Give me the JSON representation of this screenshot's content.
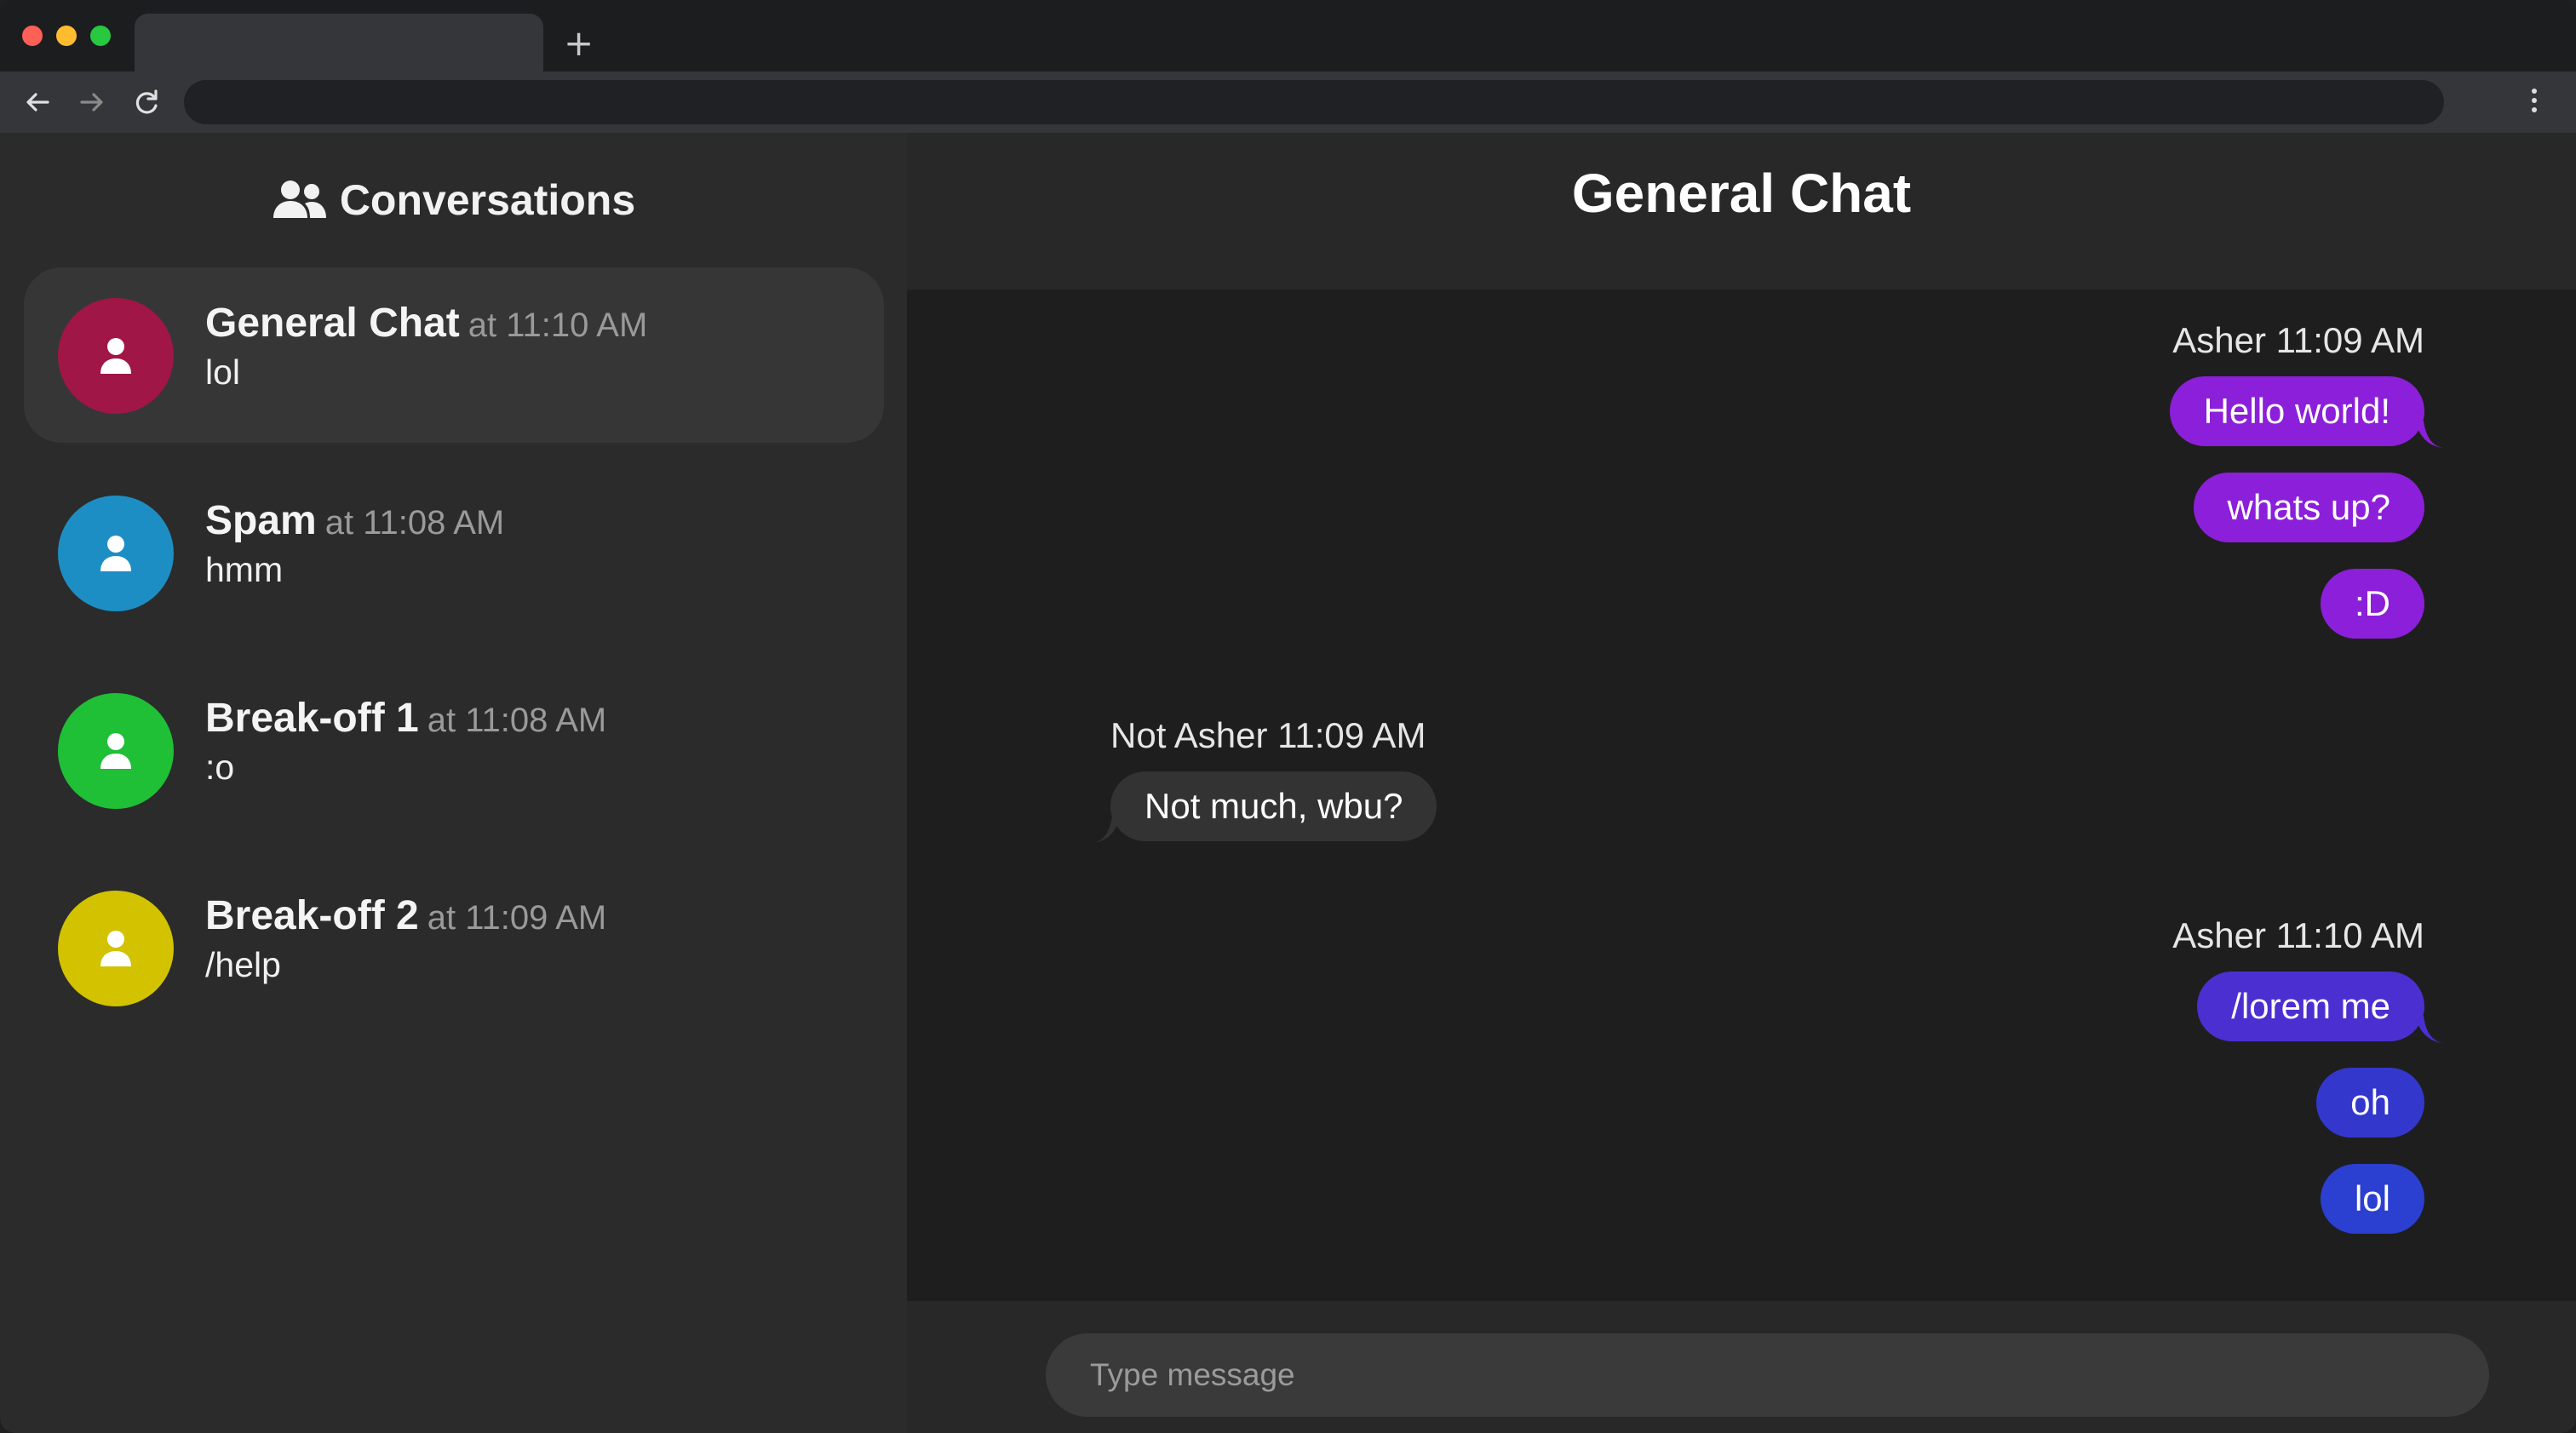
{
  "browser": {
    "tab_title": "",
    "new_tab_icon": "+",
    "url": ""
  },
  "sidebar": {
    "title": "Conversations",
    "conversations": [
      {
        "name": "General Chat",
        "time": "at 11:10 AM",
        "last": "lol",
        "color": "#a01646",
        "active": true
      },
      {
        "name": "Spam",
        "time": "at 11:08 AM",
        "last": "hmm",
        "color": "#1d8ec4",
        "active": false
      },
      {
        "name": "Break-off 1",
        "time": "at 11:08 AM",
        "last": ":o",
        "color": "#1fbf36",
        "active": false
      },
      {
        "name": "Break-off 2",
        "time": "at 11:09 AM",
        "last": "/help",
        "color": "#d2c200",
        "active": false
      }
    ]
  },
  "chat": {
    "title": "General Chat",
    "groups": [
      {
        "meta": "Asher 11:09 AM",
        "side": "right",
        "messages": [
          "Hello world!",
          "whats up?",
          ":D"
        ],
        "color": "#8c1fd9"
      },
      {
        "meta": "Not Asher 11:09 AM",
        "side": "left",
        "messages": [
          "Not much, wbu?"
        ],
        "color": "#333333"
      },
      {
        "meta": "Asher 11:10 AM",
        "side": "right",
        "messages": [
          "/lorem me",
          "oh",
          "lol"
        ],
        "colors": [
          "#4b2fd0",
          "#3437cc",
          "#2b3fd0"
        ]
      }
    ],
    "input_placeholder": "Type message"
  }
}
